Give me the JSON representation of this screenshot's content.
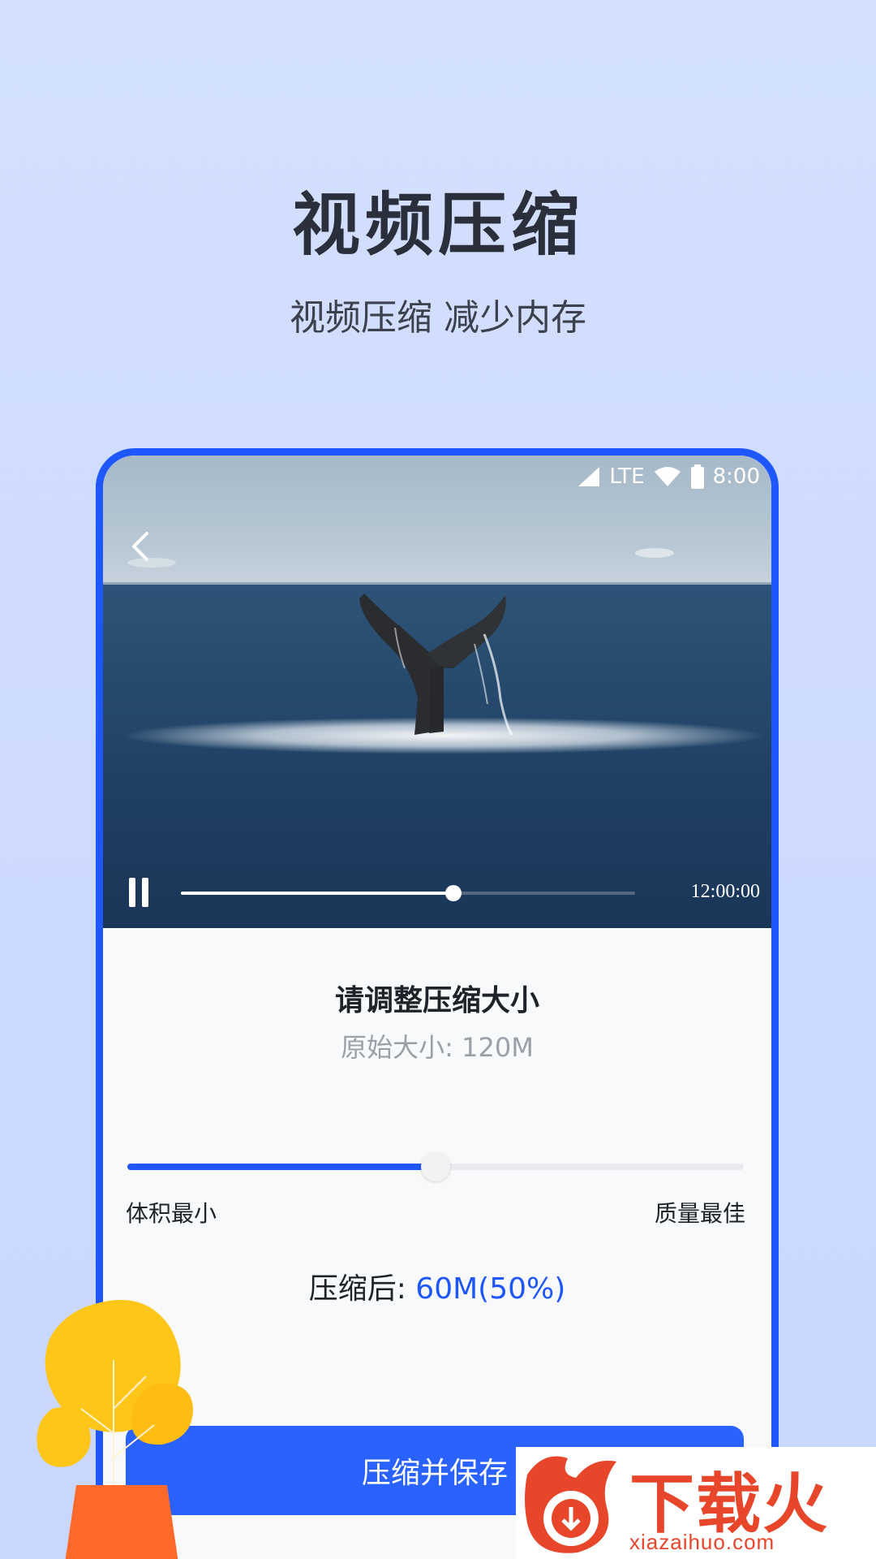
{
  "hero": {
    "title": "视频压缩",
    "subtitle": "视频压缩 减少内存"
  },
  "status_bar": {
    "network": "LTE",
    "time": "8:00",
    "icons": [
      "cellular-signal-icon",
      "wifi-icon",
      "battery-icon"
    ]
  },
  "player": {
    "back_icon": "chevron-left-icon",
    "pause_icon": "pause-icon",
    "progress": 0.6,
    "duration": "12:00:00"
  },
  "panel": {
    "title": "请调整压缩大小",
    "original_size": "原始大小: 120M",
    "slider": {
      "value": 0.5,
      "min_label": "体积最小",
      "max_label": "质量最佳"
    },
    "result_label": "压缩后: ",
    "result_value": "60M(50%)",
    "action_label": "压缩并保存"
  },
  "watermark": {
    "brand": "下载火",
    "url": "xiazaihuo.com"
  },
  "colors": {
    "accent": "#1f57ff",
    "button": "#2962ff",
    "background": "#cfdcff",
    "watermark": "#e8462b"
  }
}
